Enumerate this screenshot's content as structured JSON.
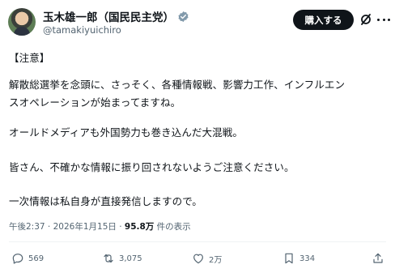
{
  "author": {
    "name": "玉木雄一郎（国民民主党）",
    "handle": "@tamakiyuichiro"
  },
  "header": {
    "buy_label": "購入する"
  },
  "post": {
    "lines": [
      "【注意】",
      "解散総選挙を念頭に、さっそく、各種情報戦、影響力工作、インフルエン",
      "スオペレーションが始まってますね。",
      "オールドメディアも外国勢力も巻き込んだ大混戦。",
      "皆さん、不確かな情報に振り回されないようご注意ください。",
      "一次情報は私自身が直接発信しますので。"
    ]
  },
  "meta": {
    "time": "午後2:37",
    "separator1": " · ",
    "date": "2026年1月15日",
    "separator2": " · ",
    "views_count": "95.8万",
    "views_label": " 件の表示"
  },
  "actions": {
    "replies": "569",
    "reposts": "3,075",
    "likes": "2万",
    "bookmarks": "334"
  },
  "colors": {
    "text": "#0f1419",
    "secondary": "#536471",
    "verified": "#829aab",
    "button_bg": "#0f1419"
  },
  "icons": {
    "verified": "verified-badge-icon",
    "grok": "grok-icon",
    "more": "more-icon",
    "reply": "reply-icon",
    "repost": "repost-icon",
    "like": "heart-icon",
    "bookmark": "bookmark-icon",
    "share": "share-icon"
  }
}
